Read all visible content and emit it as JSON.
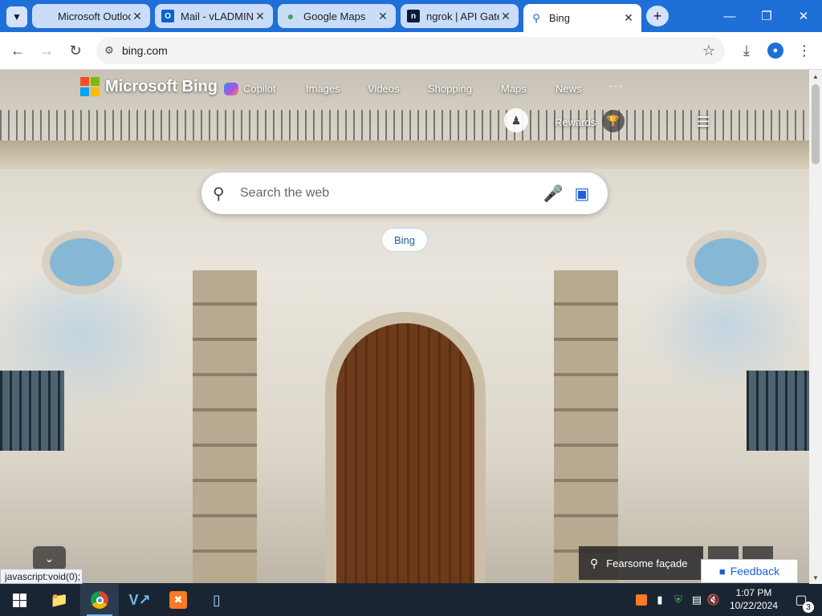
{
  "browser": {
    "tabs": [
      {
        "title": "Microsoft Outlook",
        "icon": "microsoft-logo-icon"
      },
      {
        "title": "Mail - vLADMIN",
        "icon": "outlook-icon"
      },
      {
        "title": "Google Maps",
        "icon": "maps-pin-icon"
      },
      {
        "title": "ngrok | API Gateway",
        "icon": "ngrok-icon"
      },
      {
        "title": "Bing",
        "icon": "search-icon"
      }
    ],
    "active_tab": 4,
    "url": "bing.com",
    "accent_color": "#1f6fd8"
  },
  "bing": {
    "brand": "Microsoft Bing",
    "nav": [
      "Copilot",
      "Images",
      "Videos",
      "Shopping",
      "Maps",
      "News"
    ],
    "more": "···",
    "rewards_label": "Rewards",
    "search_placeholder": "Search the web",
    "chip_label": "Bing",
    "image_caption": "Fearsome façade",
    "feedback_label": "Feedback"
  },
  "status_bar_text": "javascript:void(0);",
  "taskbar": {
    "time": "1:07 PM",
    "date": "10/22/2024",
    "notification_count": "3"
  }
}
